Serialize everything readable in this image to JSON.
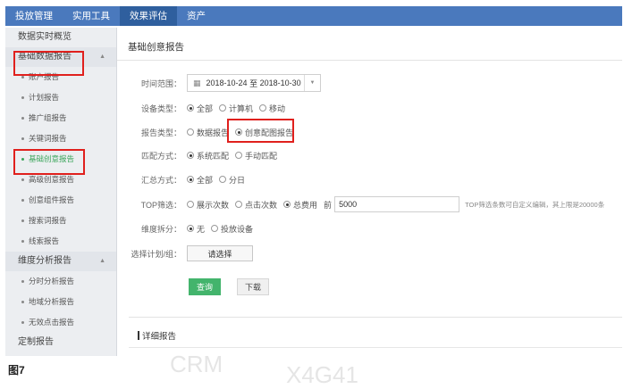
{
  "topbar": {
    "tabs": [
      {
        "label": "投放管理"
      },
      {
        "label": "实用工具"
      },
      {
        "label": "效果评估"
      },
      {
        "label": "资产"
      }
    ],
    "active_index": 2
  },
  "sidebar": {
    "realtime_overview": "数据实时概览",
    "group_basic": "基础数据报告",
    "basic_items": [
      "账户报告",
      "计划报告",
      "推广组报告",
      "关键词报告",
      "基础创意报告",
      "高级创意报告",
      "创意组件报告",
      "搜索词报告",
      "线索报告"
    ],
    "active_item": "基础创意报告",
    "group_dimension": "维度分析报告",
    "dimension_items": [
      "分时分析报告",
      "地域分析报告",
      "无效点击报告"
    ],
    "custom_report": "定制报告"
  },
  "main": {
    "page_title": "基础创意报告",
    "time_range": {
      "label": "时间范围：",
      "start": "2018-10-24",
      "sep": "至",
      "end": "2018-10-30"
    },
    "device_type": {
      "label": "设备类型：",
      "options": [
        "全部",
        "计算机",
        "移动"
      ],
      "selected": "全部"
    },
    "report_type": {
      "label": "报告类型：",
      "options": [
        "数据报告",
        "创意配图报告"
      ],
      "selected": "创意配图报告"
    },
    "match_mode": {
      "label": "匹配方式：",
      "options": [
        "系统匹配",
        "手动匹配"
      ],
      "selected": "系统匹配"
    },
    "summary_mode": {
      "label": "汇总方式：",
      "options": [
        "全部",
        "分日"
      ],
      "selected": "全部"
    },
    "top_filter": {
      "label": "TOP筛选：",
      "options": [
        "展示次数",
        "点击次数",
        "总费用"
      ],
      "selected": "总费用",
      "front_label": "前",
      "value": "5000",
      "hint": "TOP筛选条数可自定义编辑，其上限是20000条"
    },
    "dimension_split": {
      "label": "维度拆分：",
      "options": [
        "无",
        "投放设备"
      ],
      "selected": "无"
    },
    "select_plan": {
      "label": "选择计划/组：",
      "button": "请选择"
    },
    "query_button": "查询",
    "download_button": "下载",
    "detail_title": "详细报告"
  },
  "caption": "图7",
  "watermark": [
    "CRM",
    "X4G41"
  ]
}
